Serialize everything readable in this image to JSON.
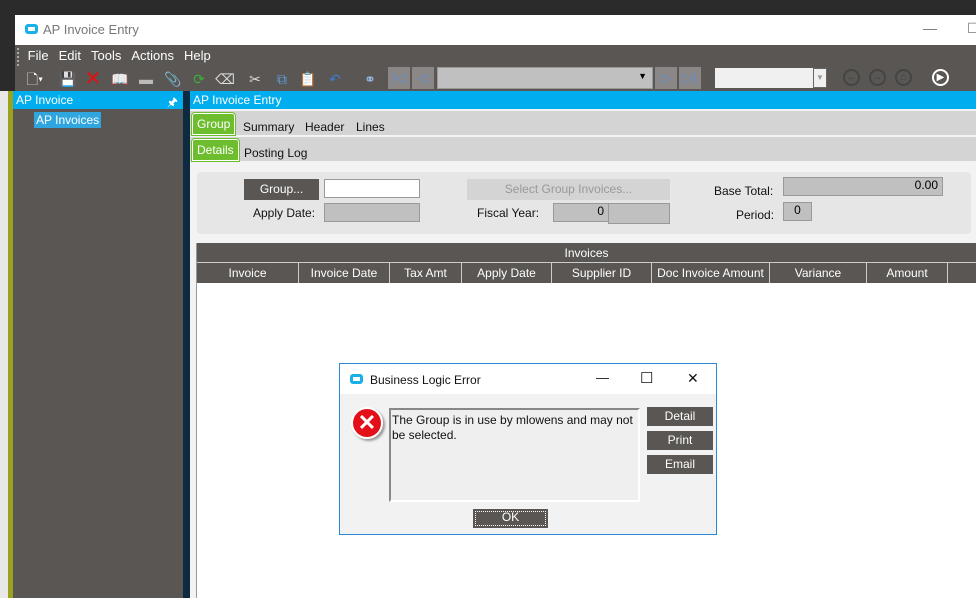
{
  "window": {
    "title": "AP Invoice Entry",
    "minimize": "—",
    "maximize": "☐"
  },
  "menu": [
    "File",
    "Edit",
    "Tools",
    "Actions",
    "Help"
  ],
  "toolbar": {
    "icons": [
      "new-icon",
      "save-icon",
      "delete-icon",
      "book-icon",
      "folder-icon",
      "attach-icon",
      "refresh-icon",
      "eraser-icon",
      "cut-icon",
      "copy-icon",
      "paste-icon",
      "undo-icon",
      "binoculars-icon",
      "first-icon",
      "prev-icon",
      "next-icon",
      "last-icon",
      "back-icon",
      "forward-icon",
      "home-icon",
      "play-icon"
    ],
    "record_combo": "",
    "nav_combo": ""
  },
  "sidebar": {
    "title": "AP Invoice",
    "pin": "🖈",
    "items": [
      "AP Invoices"
    ]
  },
  "main": {
    "title": "AP Invoice Entry",
    "tabs": [
      "Group",
      "Summary",
      "Header",
      "Lines"
    ],
    "subtabs": [
      "Details",
      "Posting Log"
    ],
    "group_button": "Group...",
    "group_value": "",
    "apply_date_label": "Apply Date:",
    "apply_date": "",
    "select_group_invoices": "Select Group Invoices...",
    "fiscal_year_label": "Fiscal Year:",
    "fiscal_year": "0",
    "fiscal_year_suffix": "",
    "base_total_label": "Base Total:",
    "base_total": "0.00",
    "period_label": "Period:",
    "period": "0",
    "grid": {
      "title": "Invoices",
      "columns": [
        "Invoice",
        "Invoice Date",
        "Tax Amt",
        "Apply Date",
        "Supplier ID",
        "Doc Invoice Amount",
        "Variance",
        "Amount"
      ]
    }
  },
  "dialog": {
    "title": "Business Logic Error",
    "message": "The Group is in use by mlowens and may not be selected.",
    "buttons": [
      "Detail",
      "Print",
      "Email"
    ],
    "ok": "OK",
    "minimize": "—",
    "maximize": "☐",
    "close": "✕"
  }
}
